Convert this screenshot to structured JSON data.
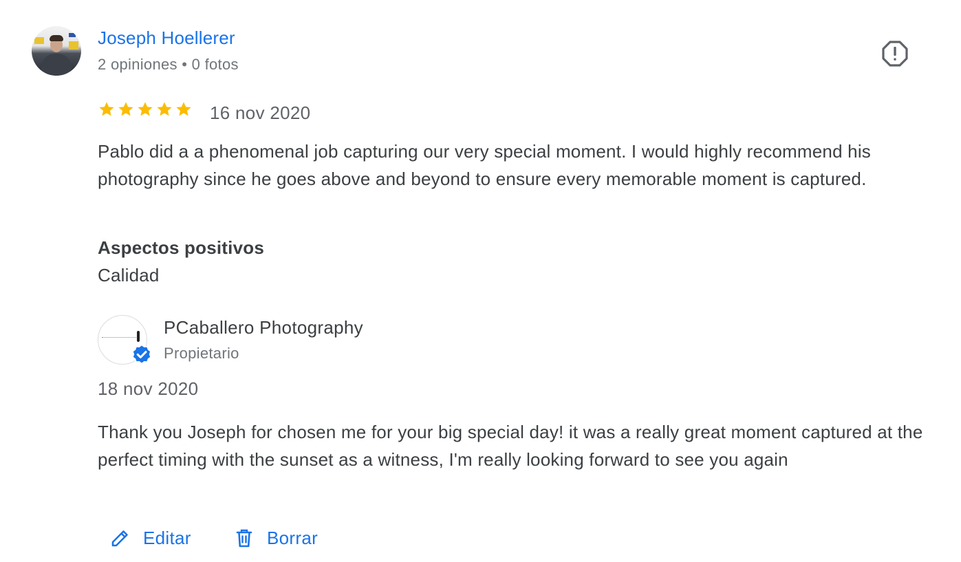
{
  "review": {
    "author": {
      "name": "Joseph Hoellerer",
      "meta": "2 opiniones • 0 fotos"
    },
    "rating": 5,
    "rating_max": 5,
    "date": "16 nov 2020",
    "text": "Pablo did a a phenomenal job capturing our very special moment. I would highly recommend his photography since he goes above and beyond to ensure every memorable moment is captured.",
    "positives": {
      "heading": "Aspectos positivos",
      "value": "Calidad"
    },
    "report_icon": "report-icon"
  },
  "owner_reply": {
    "name": "PCaballero Photography",
    "role": "Propietario",
    "date": "18 nov 2020",
    "text": "Thank you Joseph for chosen me for your big special day! it was a really great moment captured at the perfect timing with the sunset as a witness, I'm really looking forward to see you again",
    "verified_icon": "verified-check-icon"
  },
  "actions": {
    "edit_label": "Editar",
    "edit_icon": "pencil-icon",
    "delete_label": "Borrar",
    "delete_icon": "trash-icon"
  },
  "colors": {
    "link_blue": "#1a73e8",
    "star_yellow": "#fbbc04",
    "text_dark": "#3c4043",
    "text_muted": "#70757a"
  }
}
